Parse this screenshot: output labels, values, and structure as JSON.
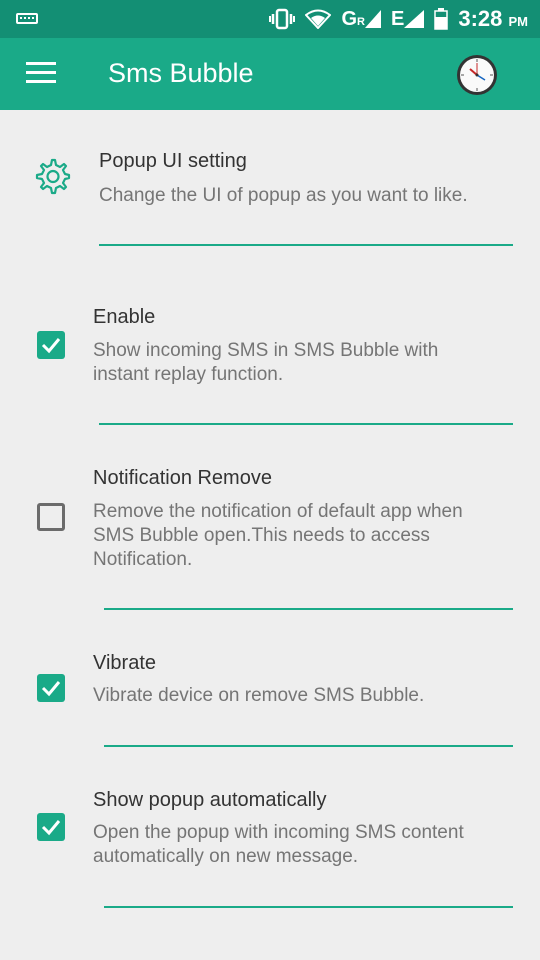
{
  "status_bar": {
    "keyboard_icon": "keyboard-icon",
    "vibrate_icon": "vibrate-icon",
    "wifi_icon": "wifi-icon",
    "signal1_label": "G",
    "signal1_sup": "R",
    "signal2_label": "E",
    "battery_icon": "battery-icon",
    "time": "3:28",
    "ampm": "PM"
  },
  "app_bar": {
    "menu_icon": "hamburger-menu-icon",
    "title": "Sms Bubble",
    "clock_icon": "clock-icon"
  },
  "preferences": [
    {
      "title": "Popup UI setting",
      "summary": "Change the UI of popup as you want to like.",
      "control": "gear-icon"
    },
    {
      "title": "Enable",
      "summary_lines": [
        "Show incoming SMS in SMS Bubble with",
        "instant replay function."
      ],
      "checked": true
    },
    {
      "title": "Notification Remove",
      "summary_lines": [
        "Remove the notification of default app when",
        "SMS Bubble open.This needs to access",
        "Notification."
      ],
      "checked": false
    },
    {
      "title": "Vibrate",
      "summary_lines": [
        "Vibrate device on remove SMS Bubble."
      ],
      "checked": true
    },
    {
      "title": "Show popup automatically",
      "summary_lines": [
        "Open the popup with incoming SMS content",
        "automatically on new message."
      ],
      "checked": true
    }
  ],
  "colors": {
    "status_bar": "#138f74",
    "app_bar": "#1aaa88",
    "accent": "#1aaa88",
    "background": "#eeeeee"
  }
}
